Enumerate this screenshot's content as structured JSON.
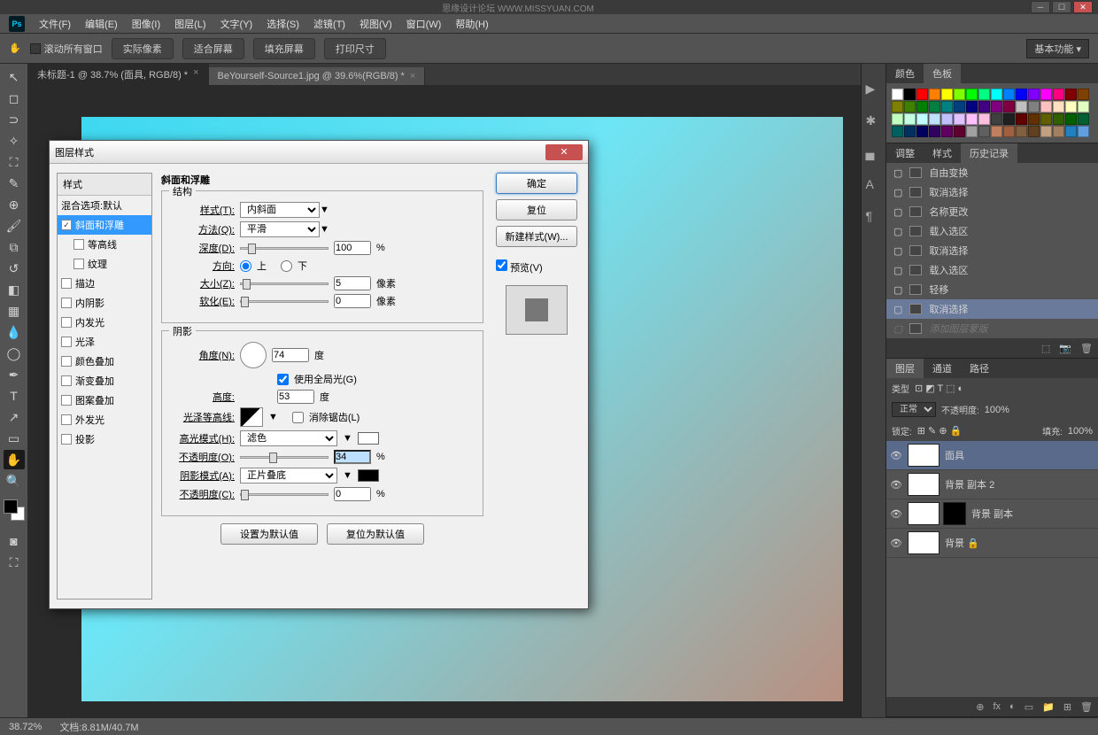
{
  "brand": "Ps",
  "watermark": "思缘设计论坛 WWW.MISSYUAN.COM",
  "menu": [
    "文件(F)",
    "编辑(E)",
    "图像(I)",
    "图层(L)",
    "文字(Y)",
    "选择(S)",
    "滤镜(T)",
    "视图(V)",
    "窗口(W)",
    "帮助(H)"
  ],
  "optbar": {
    "scroll_all": "滚动所有窗口",
    "actual": "实际像素",
    "fit": "适合屏幕",
    "fill": "填充屏幕",
    "print": "打印尺寸",
    "workspace": "基本功能"
  },
  "tabs": [
    {
      "label": "未标题-1 @ 38.7% (面具, RGB/8) *",
      "active": true
    },
    {
      "label": "BeYourself-Source1.jpg @ 39.6%(RGB/8) *",
      "active": false
    }
  ],
  "panels": {
    "color_tabs": [
      "颜色",
      "色板"
    ],
    "adjust_tabs": [
      "调整",
      "样式",
      "历史记录"
    ],
    "layer_tabs": [
      "图层",
      "通道",
      "路径"
    ]
  },
  "history": [
    {
      "label": "自由变换"
    },
    {
      "label": "取消选择"
    },
    {
      "label": "名称更改"
    },
    {
      "label": "载入选区"
    },
    {
      "label": "取消选择"
    },
    {
      "label": "载入选区"
    },
    {
      "label": "轻移"
    },
    {
      "label": "取消选择",
      "sel": true
    },
    {
      "label": "添加图层蒙版",
      "dim": true
    }
  ],
  "layers_ctrl": {
    "type_lbl": "类型",
    "mode": "正常",
    "opacity_lbl": "不透明度:",
    "opacity": "100%",
    "lock_lbl": "锁定:",
    "fill_lbl": "填充:",
    "fill": "100%"
  },
  "layers": [
    {
      "name": "面具",
      "sel": true,
      "eye": true
    },
    {
      "name": "背景 副本 2",
      "eye": true,
      "mask": false
    },
    {
      "name": "背景 副本",
      "eye": true,
      "mask": true
    },
    {
      "name": "背景",
      "eye": true,
      "locked": true
    }
  ],
  "status": {
    "zoom": "38.72%",
    "doc": "文档:8.81M/40.7M"
  },
  "dialog": {
    "title": "图层样式",
    "left_hdr": "样式",
    "blend": "混合选项:默认",
    "effects": [
      {
        "label": "斜面和浮雕",
        "checked": true,
        "sel": true
      },
      {
        "label": "等高线",
        "sub": true
      },
      {
        "label": "纹理",
        "sub": true
      },
      {
        "label": "描边"
      },
      {
        "label": "内阴影"
      },
      {
        "label": "内发光"
      },
      {
        "label": "光泽"
      },
      {
        "label": "颜色叠加"
      },
      {
        "label": "渐变叠加"
      },
      {
        "label": "图案叠加"
      },
      {
        "label": "外发光"
      },
      {
        "label": "投影"
      }
    ],
    "section_title": "斜面和浮雕",
    "structure": "结构",
    "style_lbl": "样式(T):",
    "style_val": "内斜面",
    "method_lbl": "方法(Q):",
    "method_val": "平滑",
    "depth_lbl": "深度(D):",
    "depth_val": "100",
    "pct": "%",
    "dir_lbl": "方向:",
    "up": "上",
    "down": "下",
    "size_lbl": "大小(Z):",
    "size_val": "5",
    "px": "像素",
    "soften_lbl": "软化(E):",
    "soften_val": "0",
    "shadow": "阴影",
    "angle_lbl": "角度(N):",
    "angle_val": "74",
    "deg": "度",
    "global": "使用全局光(G)",
    "alt_lbl": "高度:",
    "alt_val": "53",
    "gloss_lbl": "光泽等高线:",
    "anti": "消除锯齿(L)",
    "hlmode_lbl": "高光模式(H):",
    "hlmode_val": "滤色",
    "opac1_lbl": "不透明度(O):",
    "opac1_val": "34",
    "shmode_lbl": "阴影模式(A):",
    "shmode_val": "正片叠底",
    "opac2_lbl": "不透明度(C):",
    "opac2_val": "0",
    "set_default": "设置为默认值",
    "reset_default": "复位为默认值",
    "ok": "确定",
    "cancel": "复位",
    "new_style": "新建样式(W)...",
    "preview": "预览(V)"
  },
  "swatch_colors": [
    "#fff",
    "#000",
    "#f00",
    "#ff8000",
    "#ff0",
    "#80ff00",
    "#0f0",
    "#00ff80",
    "#0ff",
    "#0080ff",
    "#00f",
    "#8000ff",
    "#f0f",
    "#ff0080",
    "#800000",
    "#804000",
    "#808000",
    "#408000",
    "#008000",
    "#008040",
    "#008080",
    "#004080",
    "#000080",
    "#400080",
    "#800080",
    "#800040",
    "#c0c0c0",
    "#808080",
    "#ffc0c0",
    "#ffe0c0",
    "#ffffc0",
    "#e0ffc0",
    "#c0ffc0",
    "#c0ffe0",
    "#c0ffff",
    "#c0e0ff",
    "#c0c0ff",
    "#e0c0ff",
    "#ffc0ff",
    "#ffc0e0",
    "#404040",
    "#202020",
    "#600000",
    "#603000",
    "#606000",
    "#306000",
    "#006000",
    "#006030",
    "#006060",
    "#003060",
    "#000060",
    "#300060",
    "#600060",
    "#600030",
    "#a0a0a0",
    "#606060",
    "#c08060",
    "#a06040",
    "#806040",
    "#604020",
    "#c0a080",
    "#a08060",
    "#2080c0",
    "#60a0e0"
  ]
}
